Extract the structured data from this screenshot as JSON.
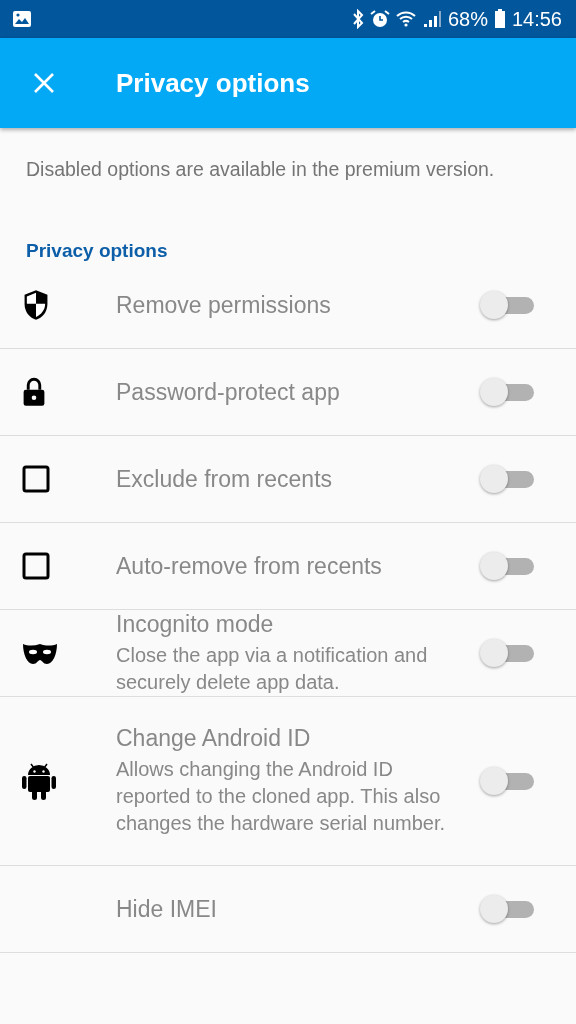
{
  "status_bar": {
    "battery": "68%",
    "time": "14:56"
  },
  "app_bar": {
    "title": "Privacy options"
  },
  "note": "Disabled options are available in the premium version.",
  "section": {
    "title": "Privacy options"
  },
  "options": [
    {
      "title": "Remove permissions",
      "on": false,
      "disabled": true
    },
    {
      "title": "Password-protect app",
      "on": false,
      "disabled": true
    },
    {
      "title": "Exclude from recents",
      "on": false,
      "disabled": true
    },
    {
      "title": "Auto-remove from recents",
      "on": false,
      "disabled": true
    },
    {
      "title": "Incognito mode",
      "summary": "Close the app via a notification and securely delete app data.",
      "on": false,
      "disabled": true
    },
    {
      "title": "Change Android ID",
      "summary": "Allows changing the Android ID reported to the cloned app. This also changes the hardware serial number.",
      "on": false,
      "disabled": true
    },
    {
      "title": "Hide IMEI",
      "on": false,
      "disabled": true
    }
  ]
}
